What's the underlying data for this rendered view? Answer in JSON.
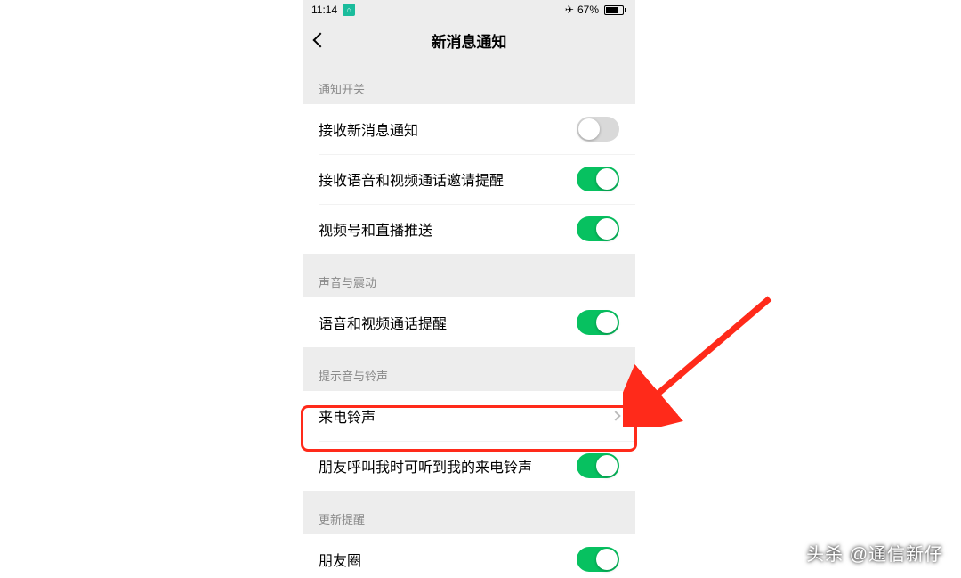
{
  "status": {
    "time": "11:14",
    "battery_pct": "67%"
  },
  "nav": {
    "title": "新消息通知"
  },
  "sections": [
    {
      "header": "通知开关"
    },
    {
      "header": "声音与震动"
    },
    {
      "header": "提示音与铃声"
    },
    {
      "header": "更新提醒"
    }
  ],
  "rows": {
    "receive_new": {
      "label": "接收新消息通知",
      "on": false
    },
    "receive_call_invite": {
      "label": "接收语音和视频通话邀请提醒",
      "on": true
    },
    "channels_push": {
      "label": "视频号和直播推送",
      "on": true
    },
    "call_alert": {
      "label": "语音和视频通话提醒",
      "on": true
    },
    "ringtone": {
      "label": "来电铃声"
    },
    "friend_hear_ringtone": {
      "label": "朋友呼叫我时可听到我的来电铃声",
      "on": true
    },
    "moments": {
      "label": "朋友圈",
      "on": true
    }
  },
  "watermark": "头杀 @通信新仔"
}
